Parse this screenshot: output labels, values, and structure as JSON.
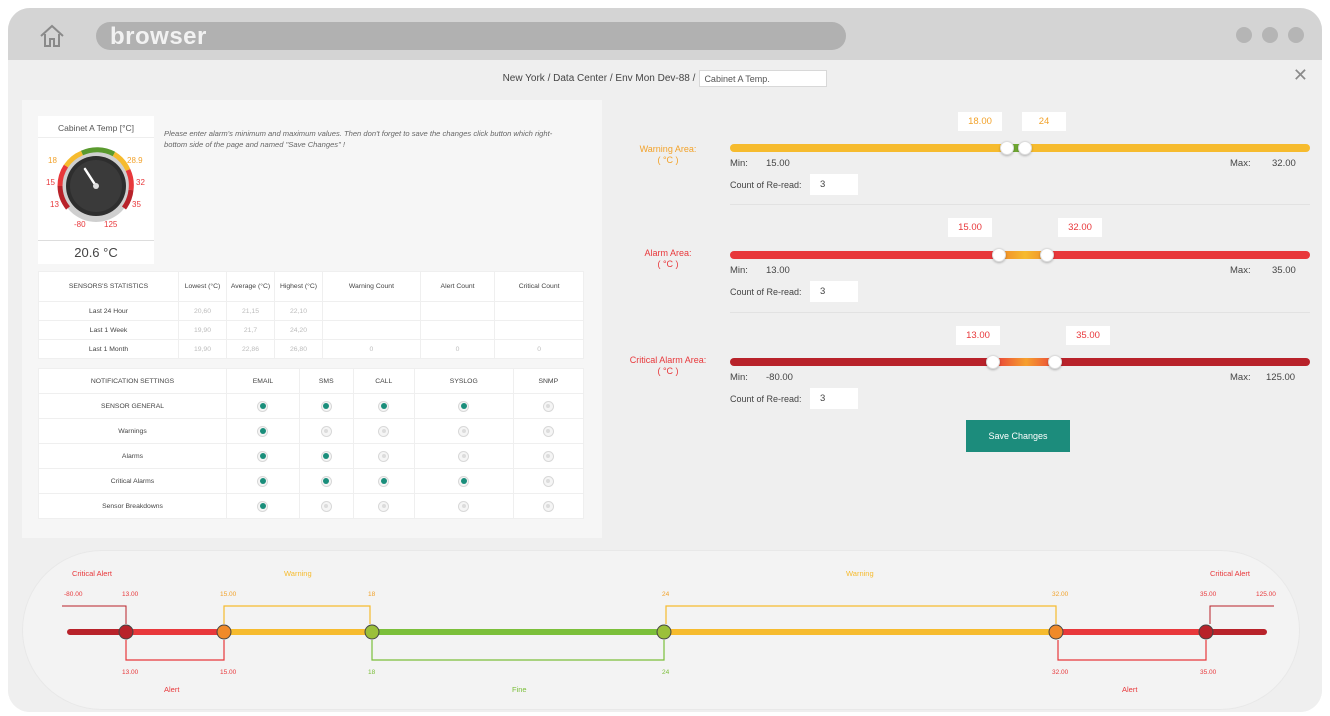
{
  "browser": {
    "url_text": "browser"
  },
  "breadcrumb": {
    "path": "New York / Data Center / Env Mon Dev-88 /",
    "input_value": "Cabinet A Temp."
  },
  "gauge": {
    "title": "Cabinet A Temp [°C]",
    "value": "20.6 °C",
    "labels": {
      "w_low": "18",
      "w_high": "28.9",
      "a_low": "15",
      "a_high": "32",
      "c_low": "13",
      "c_high": "35",
      "min": "-80",
      "max": "125"
    }
  },
  "instructions": "Please enter alarm's minimum and maximum values. Then don't forget to save the changes click button which right-bottom side of the page and named \"Save Changes\" !",
  "stats": {
    "headers": [
      "SENSORS'S STATISTICS",
      "Lowest (°C)",
      "Average (°C)",
      "Highest (°C)",
      "Warning Count",
      "Alert Count",
      "Critical Count"
    ],
    "rows": [
      {
        "label": "Last 24 Hour",
        "lowest": "20,60",
        "average": "21,15",
        "highest": "22,10",
        "warning": "",
        "alert": "",
        "critical": ""
      },
      {
        "label": "Last 1 Week",
        "lowest": "19,90",
        "average": "21,7",
        "highest": "24,20",
        "warning": "",
        "alert": "",
        "critical": ""
      },
      {
        "label": "Last 1 Month",
        "lowest": "19,90",
        "average": "22,86",
        "highest": "26,80",
        "warning": "0",
        "alert": "0",
        "critical": "0"
      }
    ]
  },
  "notifications": {
    "headers": [
      "NOTIFICATION SETTINGS",
      "EMAIL",
      "SMS",
      "CALL",
      "SYSLOG",
      "SNMP"
    ],
    "rows": [
      {
        "label": "SENSOR GENERAL",
        "flags": [
          true,
          true,
          true,
          true,
          false
        ]
      },
      {
        "label": "Warnings",
        "flags": [
          true,
          false,
          false,
          false,
          false
        ]
      },
      {
        "label": "Alarms",
        "flags": [
          true,
          true,
          false,
          false,
          false
        ]
      },
      {
        "label": "Critical Alarms",
        "flags": [
          true,
          true,
          true,
          true,
          false
        ]
      },
      {
        "label": "Sensor Breakdowns",
        "flags": [
          true,
          false,
          false,
          false,
          false
        ]
      }
    ]
  },
  "areas": {
    "warning": {
      "label": "Warning Area:",
      "unit": "( °C )",
      "low": "18.00",
      "high": "24",
      "min_label": "Min:",
      "min": "15.00",
      "max_label": "Max:",
      "max": "32.00",
      "reread_label": "Count of Re-read:",
      "reread": "3",
      "color": "#f6bb2e"
    },
    "alarm": {
      "label": "Alarm Area:",
      "unit": "( °C )",
      "low": "15.00",
      "high": "32.00",
      "min_label": "Min:",
      "min": "13.00",
      "max_label": "Max:",
      "max": "35.00",
      "reread_label": "Count of Re-read:",
      "reread": "3",
      "color": "#e8383b"
    },
    "critical": {
      "label": "Critical Alarm Area:",
      "unit": "( °C )",
      "low": "13.00",
      "high": "35.00",
      "min_label": "Min:",
      "min": "-80.00",
      "max_label": "Max:",
      "max": "125.00",
      "reread_label": "Count of Re-read:",
      "reread": "3",
      "color": "#b8222a"
    }
  },
  "save_button": "Save Changes",
  "scale": {
    "critical_alert": "Critical Alert",
    "warning": "Warning",
    "alert": "Alert",
    "fine": "Fine",
    "ticks_top": {
      "neg80": "-80.00",
      "t13": "13.00",
      "t15": "15.00",
      "t18": "18",
      "t24": "24",
      "t32": "32.00",
      "t35": "35.00",
      "t125": "125.00"
    },
    "ticks_bottom": {
      "t13": "13.00",
      "t15": "15.00",
      "t18": "18",
      "t24": "24",
      "t32": "32.00",
      "t35": "35.00"
    }
  },
  "colors": {
    "teal": "#1c8c7c",
    "warning": "#f6bb2e",
    "alarm": "#e8383b",
    "critical": "#b8222a",
    "fine": "#7bbf3a"
  }
}
